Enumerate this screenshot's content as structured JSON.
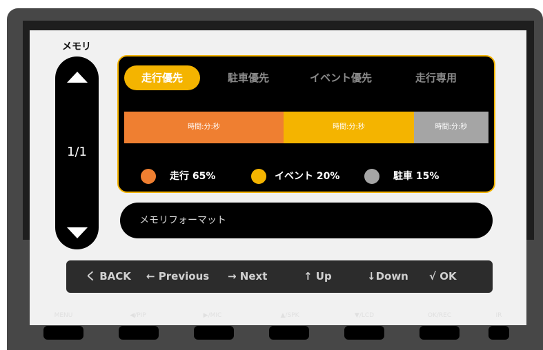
{
  "screen": {
    "title": "メモリ",
    "page_indicator": "1/1",
    "tabs": [
      {
        "label": "走行優先",
        "active": true
      },
      {
        "label": "駐車優先",
        "active": false
      },
      {
        "label": "イベント優先",
        "active": false
      },
      {
        "label": "走行専用",
        "active": false
      }
    ],
    "allocation_bar": [
      {
        "label": "時間:分:秒",
        "share": 65,
        "color": "#ef7f31"
      },
      {
        "label": "時間:分:秒",
        "share": 20,
        "color": "#f4b400"
      },
      {
        "label": "時間:分:秒",
        "share": 15,
        "color": "#a5a5a5"
      }
    ],
    "legend": [
      {
        "label": "走行 65%",
        "color": "#ef7f31"
      },
      {
        "label": "イベント 20%",
        "color": "#f4b400"
      },
      {
        "label": "駐車 15%",
        "color": "#a5a5a5"
      }
    ],
    "format_button": "メモリフォーマット"
  },
  "nav_bar": [
    {
      "label": "く BACK"
    },
    {
      "label": "← Previous"
    },
    {
      "label": "→ Next"
    },
    {
      "label": "↑ Up"
    },
    {
      "label": "↓Down"
    },
    {
      "label": "√ OK"
    }
  ],
  "hardware_buttons": [
    {
      "label": "MENU"
    },
    {
      "label": "◀/PIP"
    },
    {
      "label": "▶/MIC"
    },
    {
      "label": "▲/SPK"
    },
    {
      "label": "▼/LCD"
    },
    {
      "label": "OK/REC"
    },
    {
      "label": "IR"
    }
  ],
  "colors": {
    "accent": "#f4b400",
    "panel": "#000000",
    "device_body": "#474747"
  }
}
